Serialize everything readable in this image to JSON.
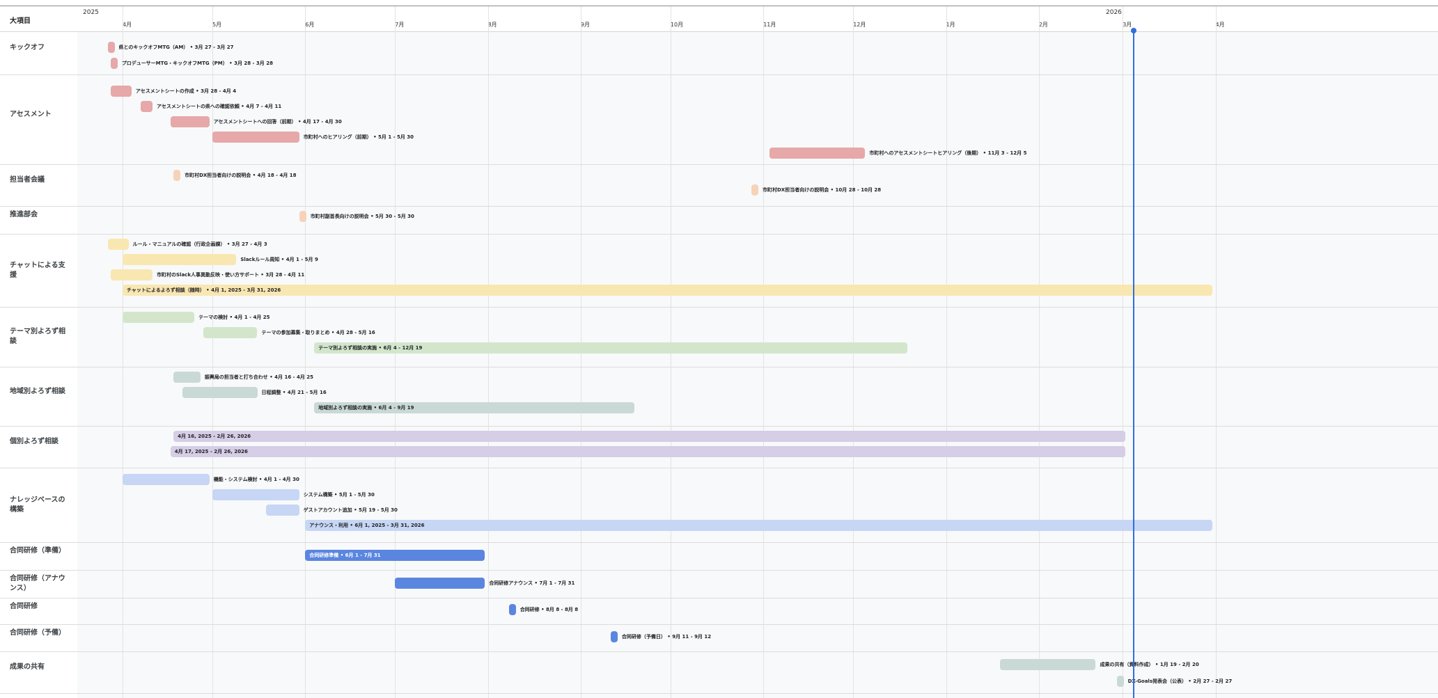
{
  "header": {
    "column_title": "大項目",
    "years": [
      {
        "label": "2025"
      },
      {
        "label": "2026"
      }
    ],
    "months": [
      "4月",
      "5月",
      "6月",
      "7月",
      "8月",
      "9月",
      "10月",
      "11月",
      "12月",
      "1月",
      "2月",
      "3月",
      "4月"
    ]
  },
  "colors": {
    "red": "#e6a8a8",
    "peach": "#f6d3b8",
    "yellow": "#f9e7b2",
    "green": "#d3e6cc",
    "teal": "#c9d9d6",
    "purple": "#d6cde6",
    "blue_light": "#c6d6f4",
    "blue": "#5b86e0",
    "today": "#2f6de1"
  },
  "groups": [
    {
      "label": "キックオフ",
      "tasks": [
        {
          "text": "県とのキックオフMTG（AM）",
          "date": "3月 27 - 3月 27",
          "color": "red",
          "start": -5,
          "dur": 0.8
        },
        {
          "text": "プロデューサーMTG・キックオフMTG（PM）",
          "date": "3月 28 - 3月 28",
          "color": "red",
          "start": -4,
          "dur": 0.8
        }
      ]
    },
    {
      "label": "アセスメント",
      "tasks": [
        {
          "text": "アセスメントシートの作成",
          "date": "3月 28 - 4月 4",
          "color": "red",
          "start": -4,
          "dur": 7
        },
        {
          "text": "アセスメントシートの県への確認依頼",
          "date": "4月 7 - 4月 11",
          "color": "red",
          "start": 6,
          "dur": 4
        },
        {
          "text": "アセスメントシートへの回答（前期）",
          "date": "4月 17 - 4月 30",
          "color": "red",
          "start": 16,
          "dur": 13
        },
        {
          "text": "市町村へのヒアリング（前期）",
          "date": "5月 1 - 5月 30",
          "color": "red",
          "start": 30,
          "dur": 29
        },
        {
          "text": "市町村へのアセスメントシートヒアリング（後期）",
          "date": "11月 3 - 12月 5",
          "color": "red",
          "start": 216,
          "dur": 32
        }
      ]
    },
    {
      "label": "担当者会議",
      "tasks": [
        {
          "text": "市町村DX担当者向けの説明会",
          "date": "4月 18 - 4月 18",
          "color": "peach",
          "start": 17,
          "dur": 0.8
        },
        {
          "text": "市町村DX担当者向けの説明会",
          "date": "10月 28 - 10月 28",
          "color": "peach",
          "start": 210,
          "dur": 0.8
        }
      ]
    },
    {
      "label": "推進部会",
      "tasks": [
        {
          "text": "市町村副首長向けの説明会",
          "date": "5月 30 - 5月 30",
          "color": "peach",
          "start": 59,
          "dur": 0.8
        }
      ]
    },
    {
      "label": "チャットによる支援",
      "tasks": [
        {
          "text": "ルール・マニュアルの確認（行政企画課）",
          "date": "3月 27 - 4月 3",
          "color": "yellow",
          "start": -5,
          "dur": 7
        },
        {
          "text": "Slackルール周知",
          "date": "4月 1 - 5月 9",
          "color": "yellow",
          "start": 0,
          "dur": 38
        },
        {
          "text": "市町村のSlack人事異動反映・使い方サポート",
          "date": "3月 28 - 4月 11",
          "color": "yellow",
          "start": -4,
          "dur": 14
        },
        {
          "text": "チャットによるよろず相談（随時）",
          "date": "4月 1, 2025 - 3月 31, 2026",
          "color": "yellow",
          "start": 0,
          "dur": 364
        }
      ]
    },
    {
      "label": "テーマ別よろず相談",
      "tasks": [
        {
          "text": "テーマの検討",
          "date": "4月 1 - 4月 25",
          "color": "green",
          "start": 0,
          "dur": 24
        },
        {
          "text": "テーマの参加募集・取りまとめ",
          "date": "4月 28 - 5月 16",
          "color": "green",
          "start": 27,
          "dur": 18
        },
        {
          "text": "テーマ別よろず相談の実施",
          "date": "6月 4 - 12月 19",
          "color": "green",
          "start": 64,
          "dur": 198
        }
      ]
    },
    {
      "label": "地域別よろず相談",
      "tasks": [
        {
          "text": "振興局の担当者と打ち合わせ",
          "date": "4月 16 - 4月 25",
          "color": "teal",
          "start": 17,
          "dur": 9
        },
        {
          "text": "日程調整",
          "date": "4月 21 - 5月 16",
          "color": "teal",
          "start": 20,
          "dur": 25
        },
        {
          "text": "地域別よろず相談の実施",
          "date": "6月 4 - 9月 19",
          "color": "teal",
          "start": 64,
          "dur": 107
        }
      ]
    },
    {
      "label": "個別よろず相談",
      "tasks": [
        {
          "text": "",
          "date": "4月 16, 2025 - 2月 26, 2026",
          "color": "purple",
          "start": 17,
          "dur": 318
        },
        {
          "text": "",
          "date": "4月 17, 2025 - 2月 26, 2026",
          "color": "purple",
          "start": 16,
          "dur": 319
        }
      ]
    },
    {
      "label": "ナレッジベースの構築",
      "tasks": [
        {
          "text": "機能・システム検討",
          "date": "4月 1 - 4月 30",
          "color": "blue_light",
          "start": 0,
          "dur": 29
        },
        {
          "text": "システム構築",
          "date": "5月 1 - 5月 30",
          "color": "blue_light",
          "start": 30,
          "dur": 29
        },
        {
          "text": "ゲストアカウント追加",
          "date": "5月 19 - 5月 30",
          "color": "blue_light",
          "start": 48,
          "dur": 11
        },
        {
          "text": "アナウンス・利用",
          "date": "6月 1, 2025 - 3月 31, 2026",
          "color": "blue_light",
          "start": 61,
          "dur": 303
        }
      ]
    },
    {
      "label": "合同研修（準備）",
      "tasks": [
        {
          "text": "合同研修準備",
          "date": "6月 1 - 7月 31",
          "color": "blue",
          "start": 61,
          "dur": 60
        }
      ]
    },
    {
      "label": "合同研修（アナウンス）",
      "tasks": [
        {
          "text": "合同研修アナウンス",
          "date": "7月 1 - 7月 31",
          "color": "blue",
          "start": 91,
          "dur": 30
        }
      ]
    },
    {
      "label": "合同研修",
      "tasks": [
        {
          "text": "合同研修",
          "date": "8月 8 - 8月 8",
          "color": "blue",
          "start": 129,
          "dur": 0.8
        }
      ]
    },
    {
      "label": "合同研修（予備）",
      "tasks": [
        {
          "text": "合同研修（予備日）",
          "date": "9月 11 - 9月 12",
          "color": "blue",
          "start": 163,
          "dur": 1
        }
      ]
    },
    {
      "label": "成果の共有",
      "tasks": [
        {
          "text": "成果の共有（資料作成）",
          "date": "1月 19 - 2月 20",
          "color": "teal",
          "start": 293,
          "dur": 32
        },
        {
          "text": "DX-Goals発表会（公表）",
          "date": "2月 27 - 2月 27",
          "color": "teal",
          "start": 332,
          "dur": 0.8
        }
      ]
    }
  ]
}
